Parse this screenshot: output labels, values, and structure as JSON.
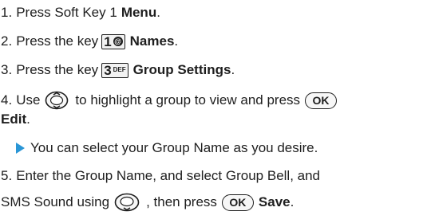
{
  "steps": [
    {
      "num": "1.",
      "text": "Press Soft Key 1",
      "bold": "Menu",
      "end": "."
    },
    {
      "num": "2.",
      "text": "Press the key",
      "key": "1",
      "key_sub": "@",
      "bold": "Names",
      "end": "."
    },
    {
      "num": "3.",
      "text": "Press the key",
      "key": "3",
      "key_sub": "DEF",
      "bold": "Group Settings",
      "end": "."
    },
    {
      "num": "4.",
      "text_a": "Use",
      "text_b": "to highlight a group to view and press",
      "ok": "OK",
      "bold": "Edit",
      "end": "."
    },
    {
      "note": "You can select your Group Name as you desire."
    },
    {
      "num": "5.",
      "text": "Enter the Group Name, and select Group Bell, and",
      "text2_a": "SMS Sound using",
      "text2_b": ", then press",
      "ok": "OK",
      "bold": "Save",
      "end": "."
    }
  ],
  "colors": {
    "text": "#1e1e1e",
    "bullet": "#2a96d6"
  }
}
